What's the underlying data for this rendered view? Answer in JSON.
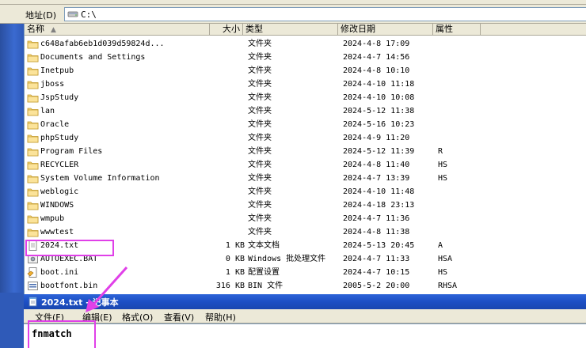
{
  "address": {
    "label": "地址(D)",
    "path": "C:\\"
  },
  "columns": {
    "name": "名称",
    "size": "大小",
    "type": "类型",
    "date": "修改日期",
    "attr": "属性"
  },
  "files": [
    {
      "name": "c648afab6eb1d039d59824d...",
      "size": "",
      "type": "文件夹",
      "date": "2024-4-8 17:09",
      "attr": "",
      "icon": "folder-icon"
    },
    {
      "name": "Documents and Settings",
      "size": "",
      "type": "文件夹",
      "date": "2024-4-7 14:56",
      "attr": "",
      "icon": "folder-icon"
    },
    {
      "name": "Inetpub",
      "size": "",
      "type": "文件夹",
      "date": "2024-4-8 10:10",
      "attr": "",
      "icon": "folder-icon"
    },
    {
      "name": "jboss",
      "size": "",
      "type": "文件夹",
      "date": "2024-4-10 11:18",
      "attr": "",
      "icon": "folder-icon"
    },
    {
      "name": "JspStudy",
      "size": "",
      "type": "文件夹",
      "date": "2024-4-10 10:08",
      "attr": "",
      "icon": "folder-icon"
    },
    {
      "name": "lan",
      "size": "",
      "type": "文件夹",
      "date": "2024-5-12 11:38",
      "attr": "",
      "icon": "folder-icon"
    },
    {
      "name": "Oracle",
      "size": "",
      "type": "文件夹",
      "date": "2024-5-16 10:23",
      "attr": "",
      "icon": "folder-icon"
    },
    {
      "name": "phpStudy",
      "size": "",
      "type": "文件夹",
      "date": "2024-4-9 11:20",
      "attr": "",
      "icon": "folder-icon"
    },
    {
      "name": "Program Files",
      "size": "",
      "type": "文件夹",
      "date": "2024-5-12 11:39",
      "attr": "R",
      "icon": "folder-icon"
    },
    {
      "name": "RECYCLER",
      "size": "",
      "type": "文件夹",
      "date": "2024-4-8 11:40",
      "attr": "HS",
      "icon": "folder-icon"
    },
    {
      "name": "System Volume Information",
      "size": "",
      "type": "文件夹",
      "date": "2024-4-7 13:39",
      "attr": "HS",
      "icon": "folder-icon"
    },
    {
      "name": "weblogic",
      "size": "",
      "type": "文件夹",
      "date": "2024-4-10 11:48",
      "attr": "",
      "icon": "folder-icon"
    },
    {
      "name": "WINDOWS",
      "size": "",
      "type": "文件夹",
      "date": "2024-4-18 23:13",
      "attr": "",
      "icon": "folder-icon"
    },
    {
      "name": "wmpub",
      "size": "",
      "type": "文件夹",
      "date": "2024-4-7 11:36",
      "attr": "",
      "icon": "folder-icon"
    },
    {
      "name": "wwwtest",
      "size": "",
      "type": "文件夹",
      "date": "2024-4-8 11:38",
      "attr": "",
      "icon": "folder-icon"
    },
    {
      "name": "2024.txt",
      "size": "1 KB",
      "type": "文本文档",
      "date": "2024-5-13 20:45",
      "attr": "A",
      "icon": "text-file-icon"
    },
    {
      "name": "AUTOEXEC.BAT",
      "size": "0 KB",
      "type": "Windows 批处理文件",
      "date": "2024-4-7 11:33",
      "attr": "HSA",
      "icon": "batch-file-icon"
    },
    {
      "name": "boot.ini",
      "size": "1 KB",
      "type": "配置设置",
      "date": "2024-4-7 10:15",
      "attr": "HS",
      "icon": "settings-file-icon"
    },
    {
      "name": "bootfont.bin",
      "size": "316 KB",
      "type": "BIN 文件",
      "date": "2005-5-2 20:00",
      "attr": "RHSA",
      "icon": "bin-file-icon"
    }
  ],
  "notepad": {
    "title": "2024.txt - 记事本",
    "menu": [
      "文件(F)",
      "编辑(E)",
      "格式(O)",
      "查看(V)",
      "帮助(H)"
    ],
    "content": "fnmatch"
  },
  "colors": {
    "highlight": "#e040e8",
    "titlebar": "#1c4fc4",
    "folder": "#f5d77a"
  }
}
